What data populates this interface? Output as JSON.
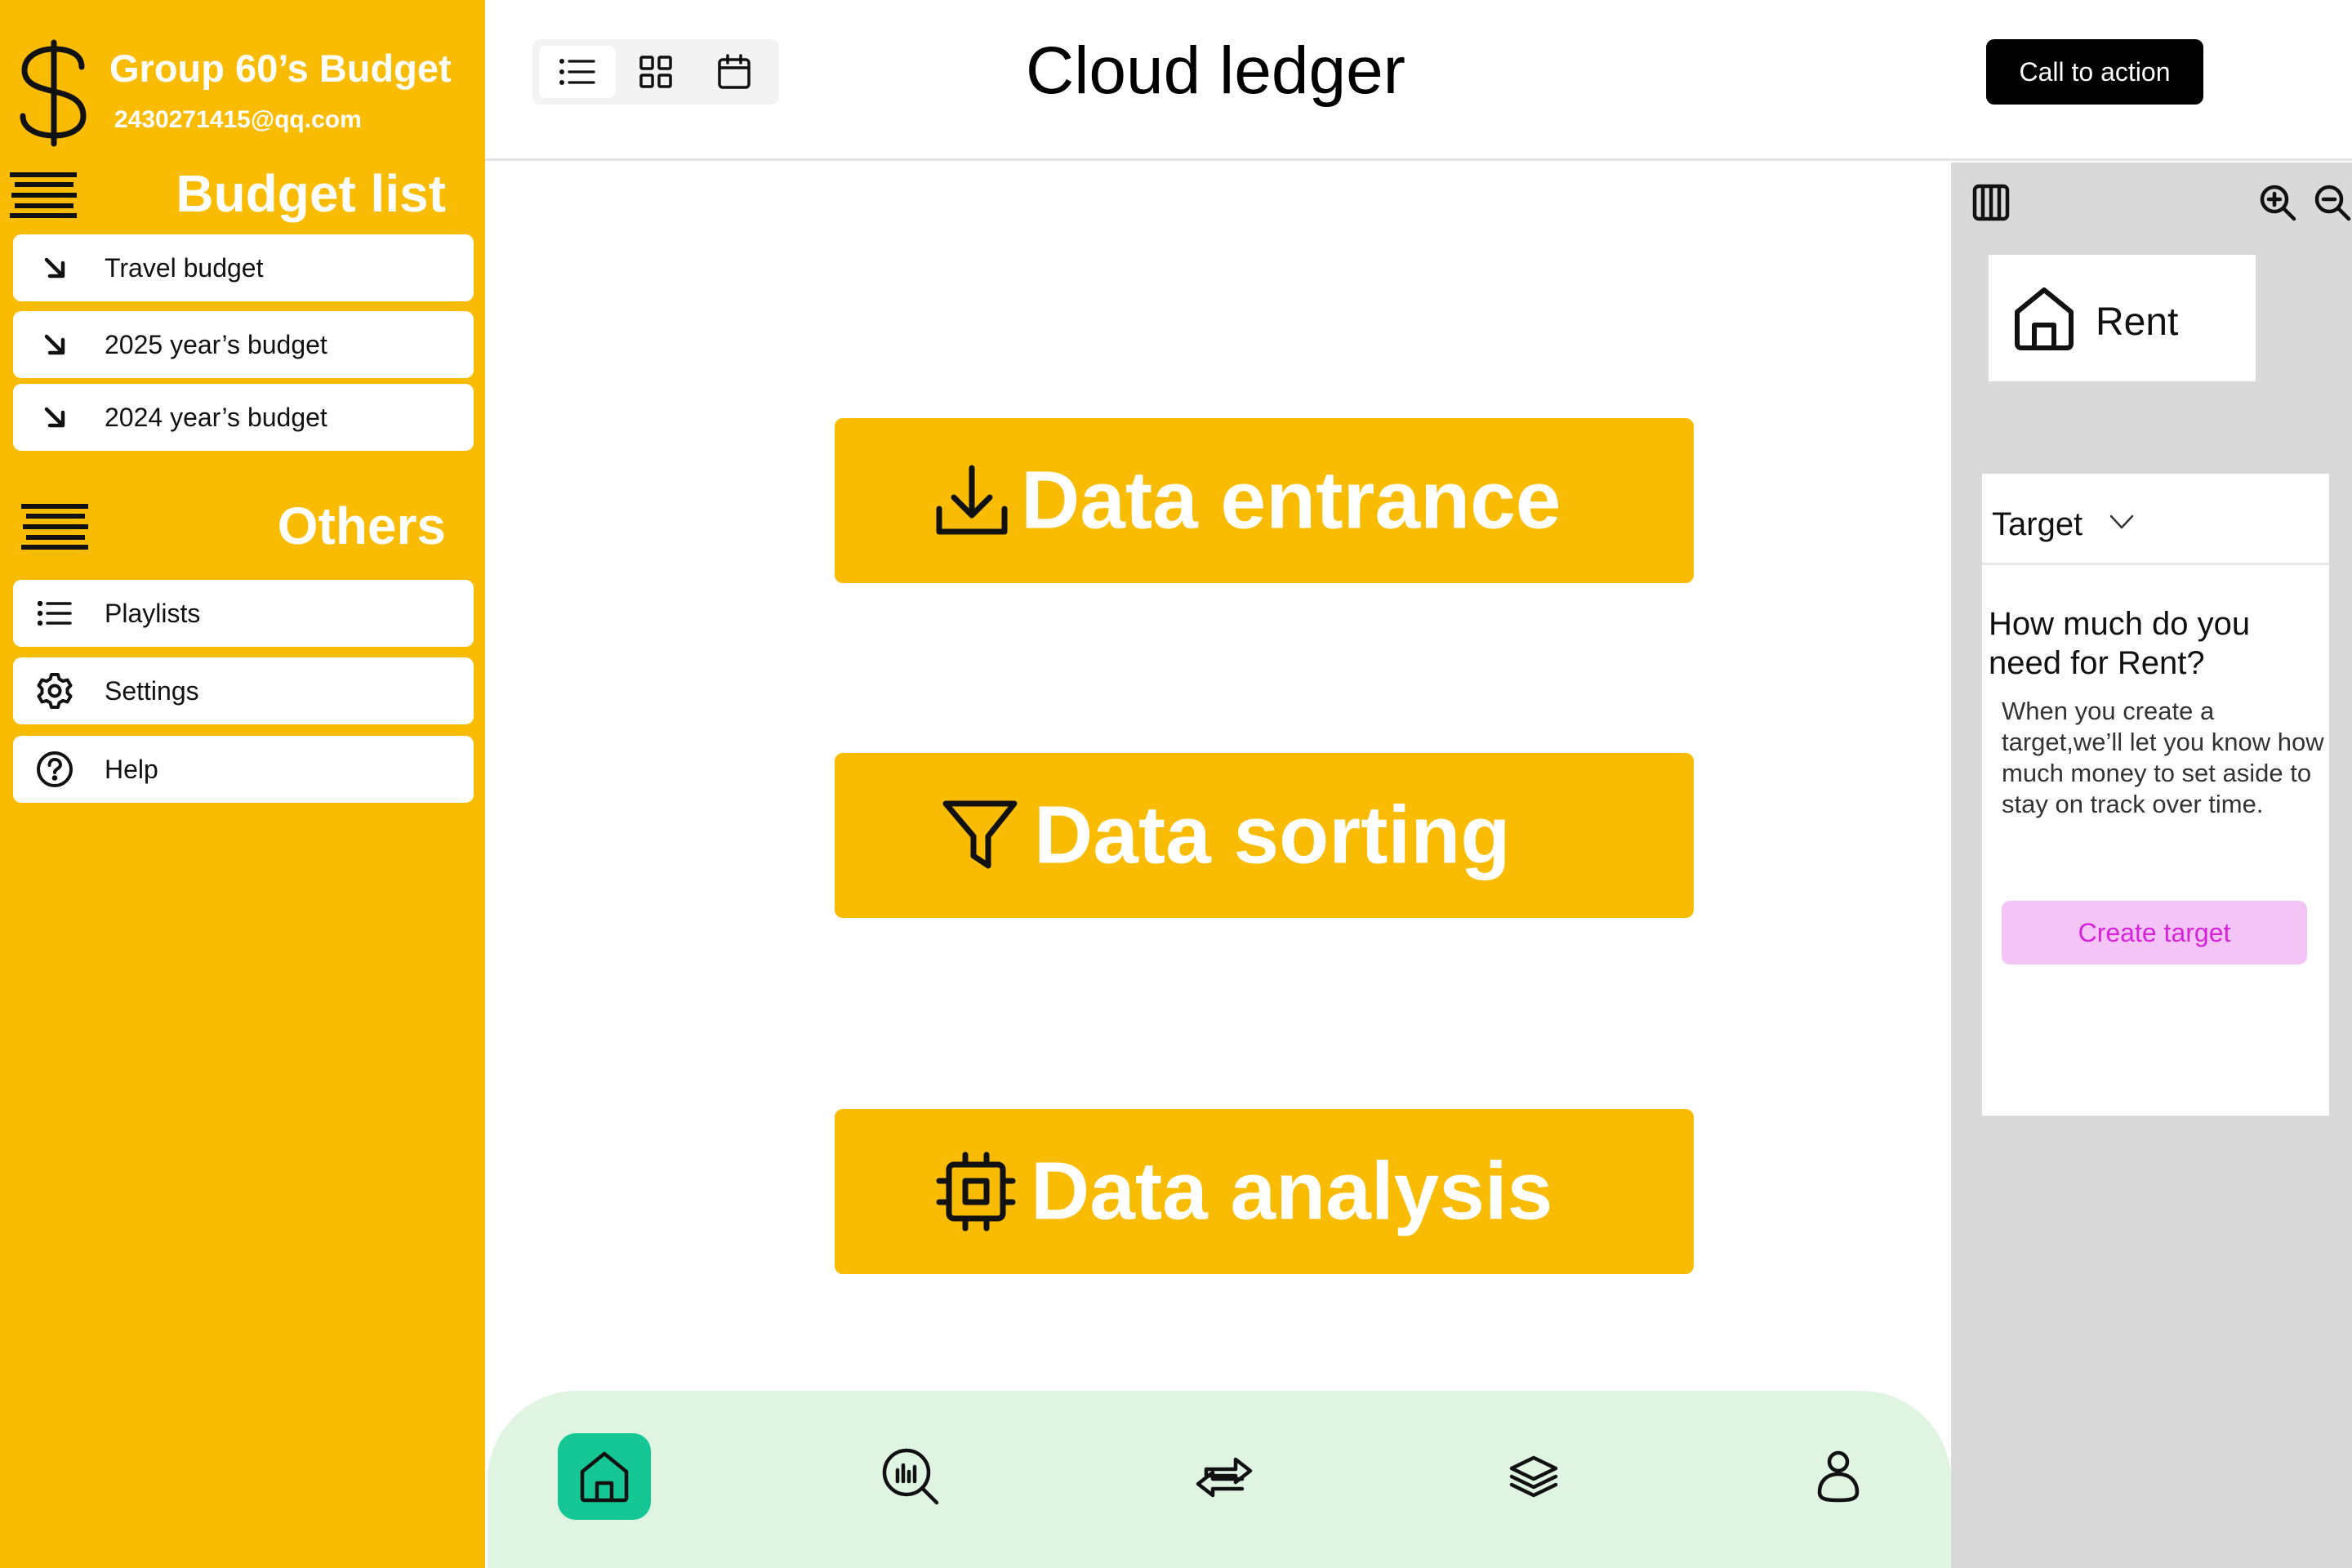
{
  "colors": {
    "accent_yellow": "#f9bc03",
    "nav_bg": "#dff5e2",
    "nav_active": "#14c795",
    "panel_bg": "#d9d9d9",
    "cta_bg": "#000000",
    "create_target_bg": "#f5c4f6",
    "create_target_text": "#d423d9"
  },
  "sidebar": {
    "brand_icon": "dollar-icon",
    "brand_title": "Group 60’s Budget",
    "brand_email": "2430271415@qq.com",
    "budget_section": {
      "title": "Budget list",
      "icon": "menu-icon",
      "items": [
        {
          "label": "Travel budget",
          "icon": "arrow-down-right-icon"
        },
        {
          "label": "2025 year’s budget",
          "icon": "arrow-down-right-icon"
        },
        {
          "label": "2024 year’s budget",
          "icon": "arrow-down-right-icon"
        }
      ]
    },
    "others_section": {
      "title": "Others",
      "icon": "menu-icon",
      "items": [
        {
          "label": "Playlists",
          "icon": "list-icon"
        },
        {
          "label": "Settings",
          "icon": "gear-icon"
        },
        {
          "label": "Help",
          "icon": "help-icon"
        }
      ]
    }
  },
  "header": {
    "view_switcher": [
      {
        "icon": "list-view-icon",
        "active": true
      },
      {
        "icon": "grid-view-icon",
        "active": false
      },
      {
        "icon": "calendar-icon",
        "active": false
      }
    ],
    "title": "Cloud ledger",
    "cta_label": "Call to action"
  },
  "main": {
    "actions": [
      {
        "label": "Data entrance",
        "icon": "download-icon"
      },
      {
        "label": "Data sorting",
        "icon": "filter-icon"
      },
      {
        "label": "Data analysis",
        "icon": "cpu-chip-icon"
      }
    ]
  },
  "bottom_nav": {
    "items": [
      {
        "icon": "home-icon",
        "active": true
      },
      {
        "icon": "analytics-search-icon",
        "active": false
      },
      {
        "icon": "transfer-arrows-icon",
        "active": false
      },
      {
        "icon": "layers-icon",
        "active": false
      },
      {
        "icon": "user-icon",
        "active": false
      }
    ]
  },
  "right_panel": {
    "toolbar_icons": [
      "columns-icon",
      "zoom-in-icon",
      "zoom-out-icon"
    ],
    "category": {
      "label": "Rent",
      "icon": "home-icon"
    },
    "target": {
      "label": "Target",
      "question": "How much do you need for Rent?",
      "description": "When you create a target,we’ll let you know how much money to set aside to stay on track over time.",
      "button_label": "Create target"
    }
  }
}
